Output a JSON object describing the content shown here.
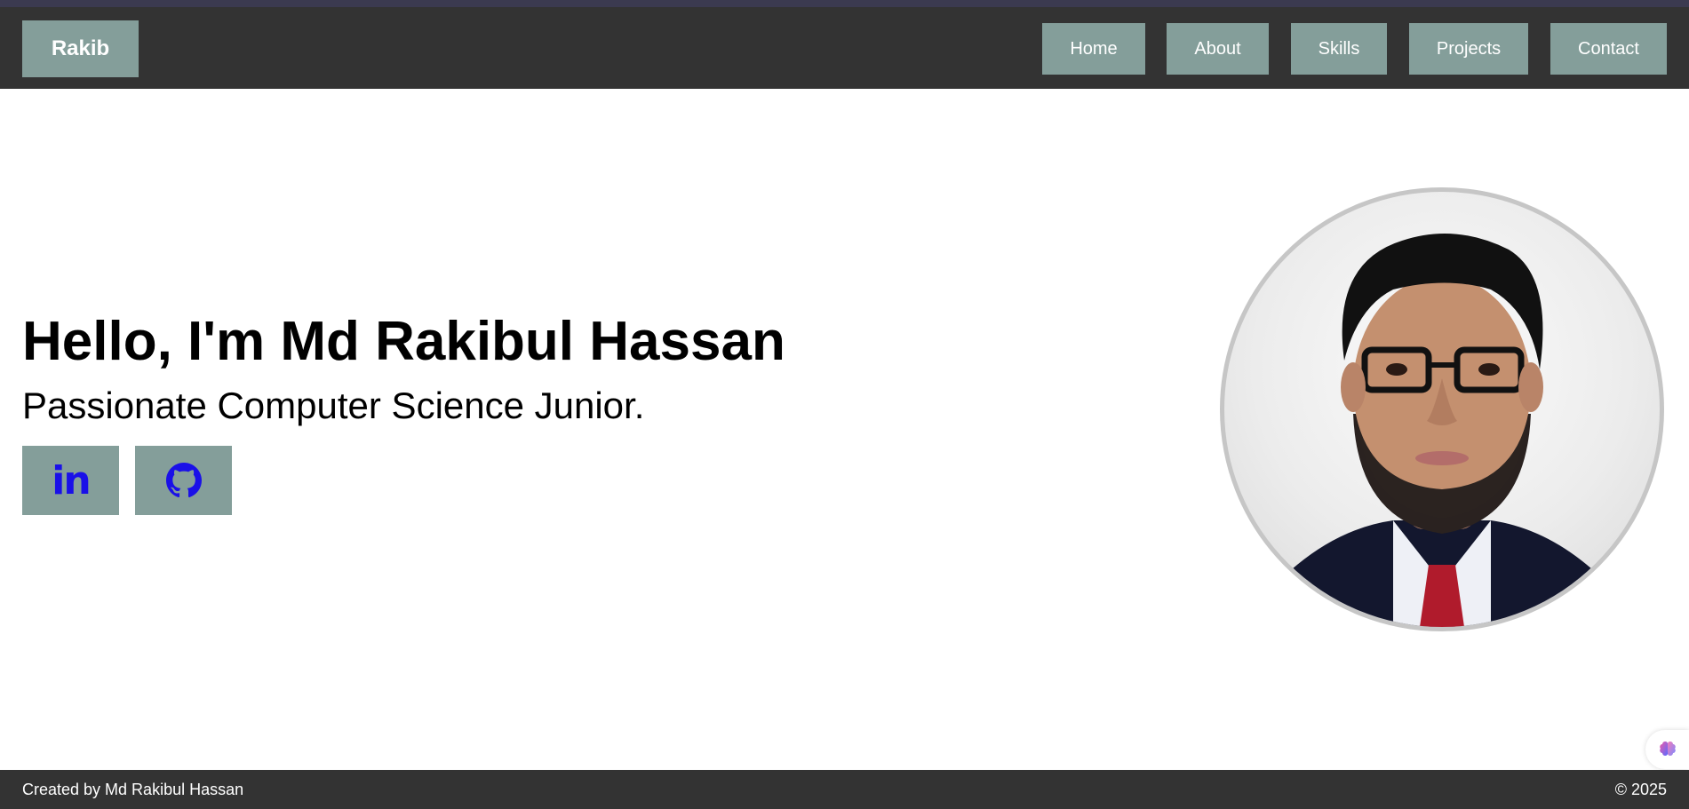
{
  "header": {
    "brand": "Rakib",
    "nav": [
      {
        "label": "Home"
      },
      {
        "label": "About"
      },
      {
        "label": "Skills"
      },
      {
        "label": "Projects"
      },
      {
        "label": "Contact"
      }
    ]
  },
  "hero": {
    "title": "Hello, I'm Md Rakibul Hassan",
    "subtitle": "Passionate Computer Science Junior.",
    "social": [
      {
        "label": "in",
        "icon": "linkedin-icon"
      },
      {
        "icon": "github-icon"
      }
    ],
    "avatar_icon": "profile-photo"
  },
  "floating_widget": {
    "icon": "brain-icon"
  },
  "footer": {
    "credit": "Created by Md Rakibul Hassan",
    "copyright": "© 2025"
  },
  "colors": {
    "nav_bg": "#333333",
    "button_bg": "#849e9a",
    "icon_blue": "#1a10e8",
    "avatar_border": "#c6c6c6"
  }
}
